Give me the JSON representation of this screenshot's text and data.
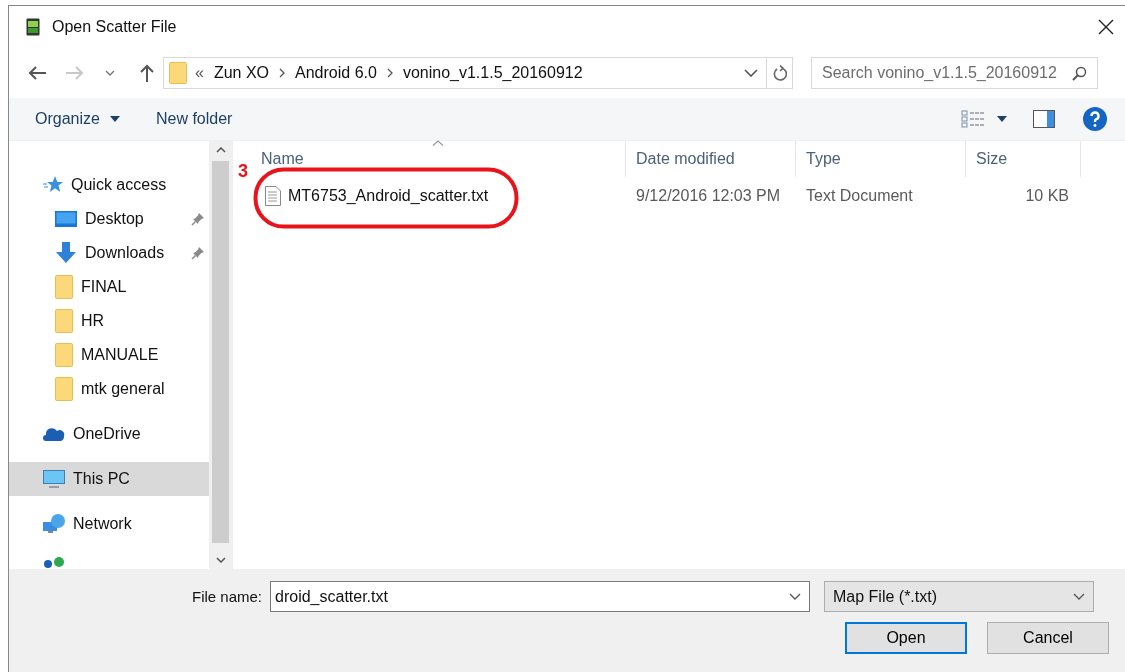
{
  "window": {
    "title": "Open Scatter File"
  },
  "address": {
    "overflow": "«",
    "path": [
      "Zun XO",
      "Android 6.0",
      "vonino_v1.1.5_20160912"
    ],
    "search_placeholder": "Search vonino_v1.1.5_20160912"
  },
  "toolbar": {
    "organize": "Organize",
    "new_folder": "New folder"
  },
  "sidebar": {
    "items": [
      {
        "label": "Quick access",
        "kind": "star",
        "selected": false,
        "children": [
          {
            "label": "Desktop",
            "kind": "desktop",
            "pinned": true,
            "selected": false
          },
          {
            "label": "Downloads",
            "kind": "download",
            "pinned": true,
            "selected": false
          },
          {
            "label": "FINAL",
            "kind": "folder",
            "pinned": false,
            "selected": false
          },
          {
            "label": "HR",
            "kind": "folder",
            "pinned": false,
            "selected": false
          },
          {
            "label": "MANUALE",
            "kind": "folder",
            "pinned": false,
            "selected": false
          },
          {
            "label": "mtk general",
            "kind": "folder",
            "pinned": false,
            "selected": false
          }
        ]
      },
      {
        "label": "OneDrive",
        "kind": "cloud",
        "selected": false
      },
      {
        "label": "This PC",
        "kind": "pc",
        "selected": true
      },
      {
        "label": "Network",
        "kind": "network",
        "selected": false
      }
    ]
  },
  "columns": [
    {
      "label": "Name",
      "sorted": true
    },
    {
      "label": "Date modified",
      "sorted": false
    },
    {
      "label": "Type",
      "sorted": false
    },
    {
      "label": "Size",
      "sorted": false
    }
  ],
  "files": [
    {
      "name": "MT6753_Android_scatter.txt",
      "date": "9/12/2016 12:03 PM",
      "type": "Text Document",
      "size": "10 KB",
      "selected": false
    }
  ],
  "annotation": {
    "label": "3"
  },
  "footer": {
    "file_name_label": "File name:",
    "file_name": "droid_scatter.txt",
    "filter": "Map File (*.txt)",
    "buttons": [
      {
        "label": "Open",
        "default": true
      },
      {
        "label": "Cancel",
        "default": false
      }
    ]
  }
}
